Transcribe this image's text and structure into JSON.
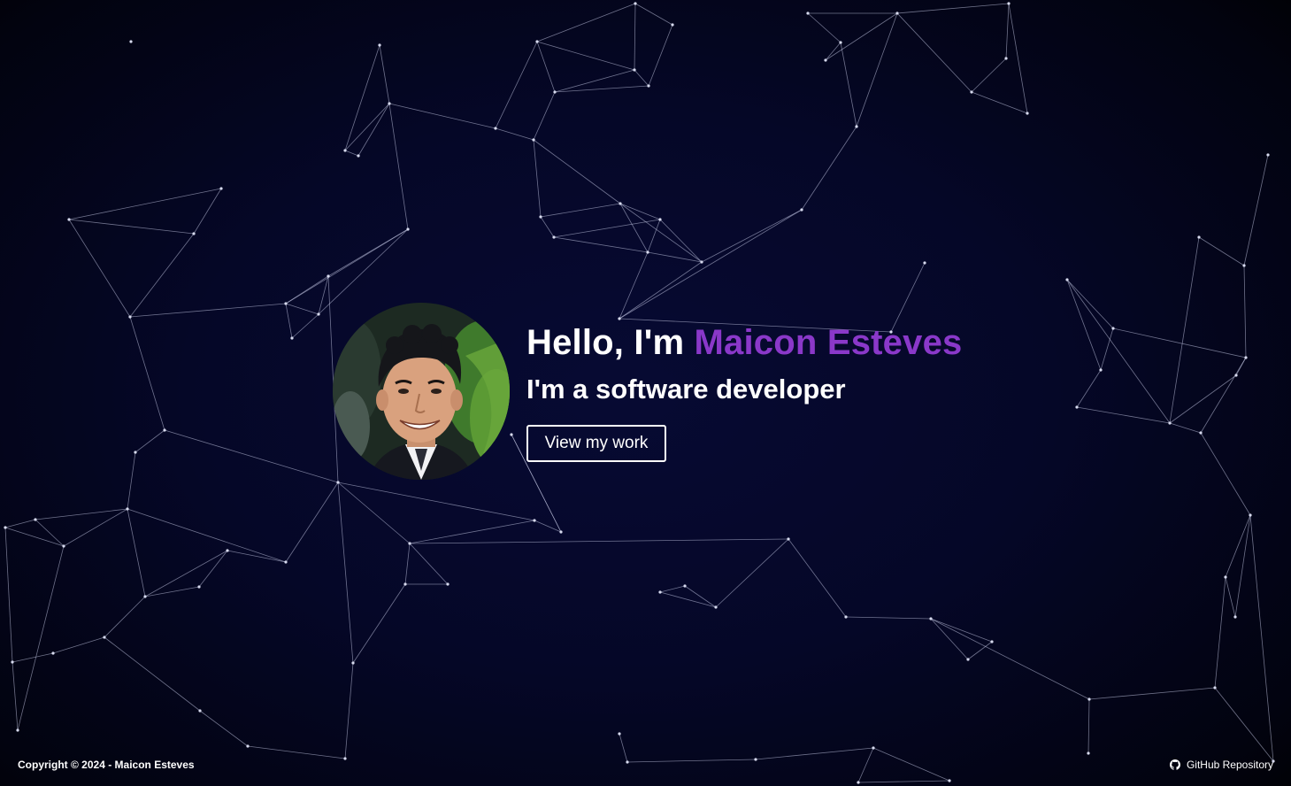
{
  "hero": {
    "greeting_prefix": "Hello, I'm ",
    "name": "Maicon Esteves",
    "subtitle": "I'm a software developer",
    "cta_label": "View my work",
    "avatar_alt": "Portrait of Maicon Esteves"
  },
  "footer": {
    "copyright_prefix": "Copyright © 2024 - ",
    "copyright_name": "Maicon Esteves",
    "repo_icon": "github-icon",
    "repo_label": "GitHub Repository"
  },
  "colors": {
    "background": "#050727",
    "accent": "#8a38c9",
    "text": "#ffffff",
    "network_line": "#9aa0c8"
  }
}
